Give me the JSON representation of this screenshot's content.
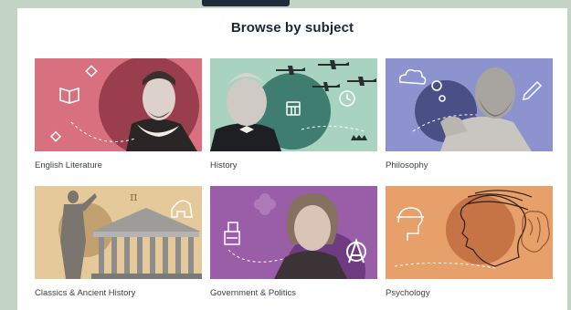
{
  "page": {
    "heading": "Browse by subject"
  },
  "colors": {
    "english": "#d8707f",
    "history": "#a9d3c1",
    "philosophy": "#8c93cf",
    "classics": "#e6c99b",
    "government": "#9a5da8",
    "psychology": "#e8a06a"
  },
  "subjects": [
    {
      "label": "English Literature",
      "icons": [
        "book-icon",
        "diamond-icon"
      ]
    },
    {
      "label": "History",
      "icons": [
        "plane-icon",
        "calendar-icon",
        "clock-icon",
        "crown-icon"
      ]
    },
    {
      "label": "Philosophy",
      "icons": [
        "cloud-icon",
        "bubble-icon",
        "pencil-icon"
      ]
    },
    {
      "label": "Classics & Ancient History",
      "icons": [
        "pi-icon",
        "helmet-icon"
      ]
    },
    {
      "label": "Government & Politics",
      "icons": [
        "ballot-box-icon",
        "flower-icon",
        "anarchy-icon"
      ]
    },
    {
      "label": "Psychology",
      "icons": [
        "head-icon",
        "brain-icon"
      ]
    }
  ]
}
